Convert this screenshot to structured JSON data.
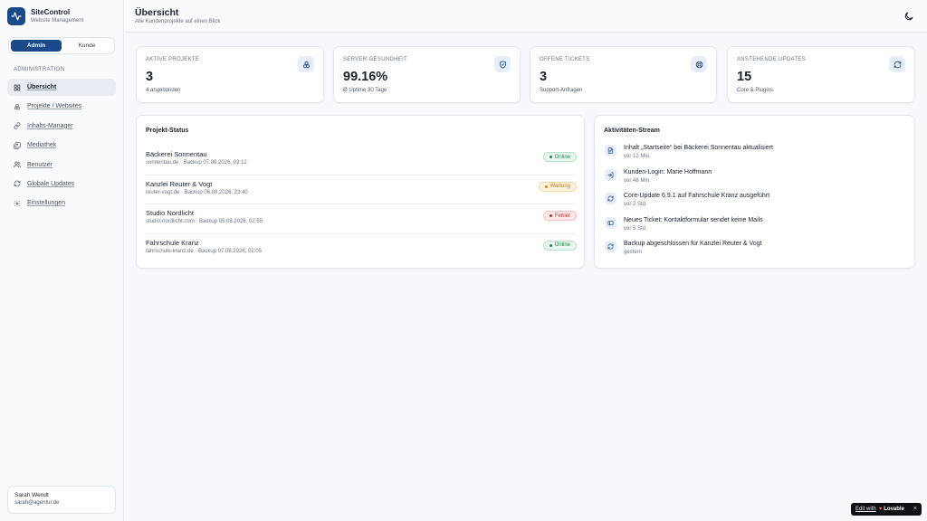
{
  "app": {
    "name": "SiteControl",
    "subtitle": "Website Management"
  },
  "role_toggle": {
    "admin": "Admin",
    "customer": "Kunde",
    "active": "admin"
  },
  "sidebar": {
    "section_label": "ADMINISTRATION",
    "items": [
      {
        "label": "Übersicht",
        "icon": "grid-icon",
        "active": true
      },
      {
        "label": "Projekte / Websites",
        "icon": "boxes-icon",
        "active": false
      },
      {
        "label": "Inhalts-Manager",
        "icon": "link-icon",
        "active": false
      },
      {
        "label": "Mediathek",
        "icon": "images-icon",
        "active": false
      },
      {
        "label": "Benutzer",
        "icon": "users-icon",
        "active": false
      },
      {
        "label": "Globale Updates",
        "icon": "refresh-icon",
        "active": false
      },
      {
        "label": "Einstellungen",
        "icon": "gear-icon",
        "active": false
      }
    ]
  },
  "user": {
    "name": "Sarah Wendt",
    "email": "sarah@agentur.de"
  },
  "header": {
    "title": "Übersicht",
    "subtitle": "Alle Kundenprojekte auf einen Blick",
    "theme_icon": "moon-icon"
  },
  "stats": [
    {
      "label": "AKTIVE PROJEKTE",
      "value": "3",
      "sub": "4 angebunden",
      "icon": "boxes-icon"
    },
    {
      "label": "SERVER-GESUNDHEIT",
      "value": "99.16%",
      "sub": "Ø Uptime 30 Tage",
      "icon": "shield-icon"
    },
    {
      "label": "OFFENE TICKETS",
      "value": "3",
      "sub": "Support-Anfragen",
      "icon": "lifebuoy-icon"
    },
    {
      "label": "ANSTEHENDE UPDATES",
      "value": "15",
      "sub": "Core & Plugins",
      "icon": "refresh-icon"
    }
  ],
  "projects": {
    "title": "Projekt-Status",
    "rows": [
      {
        "name": "Bäckerei Sonnentau",
        "meta": "sonnentau.de · Backup 07.08.2026, 03:12",
        "status": "Online",
        "status_type": "online"
      },
      {
        "name": "Kanzlei Reuter & Vogt",
        "meta": "reuter-vogt.de · Backup 06.08.2026, 23:40",
        "status": "Wartung",
        "status_type": "wartung"
      },
      {
        "name": "Studio Nordlicht",
        "meta": "studio-nordlicht.com · Backup 05.08.2026, 02:55",
        "status": "Fehler",
        "status_type": "fehler"
      },
      {
        "name": "Fahrschule Kranz",
        "meta": "fahrschule-kranz.de · Backup 07.08.2026, 02:05",
        "status": "Online",
        "status_type": "online"
      }
    ]
  },
  "activity": {
    "title": "Aktivitäten-Stream",
    "items": [
      {
        "text": "Inhalt „Startseite“ bei Bäckerei Sonnentau aktualisiert",
        "time": "vor 12 Min.",
        "icon": "file-icon"
      },
      {
        "text": "Kunden-Login: Marie Hoffmann",
        "time": "vor 48 Min.",
        "icon": "login-icon"
      },
      {
        "text": "Core-Update 6.9.1 auf Fahrschule Kranz ausgeführt",
        "time": "vor 2 Std.",
        "icon": "refresh-icon"
      },
      {
        "text": "Neues Ticket: Kontaktformular sendet keine Mails",
        "time": "vor 5 Std.",
        "icon": "ticket-icon"
      },
      {
        "text": "Backup abgeschlossen für Kanzlei Reuter & Vogt",
        "time": "gestern",
        "icon": "refresh-icon"
      }
    ]
  },
  "lovable": {
    "edit": "Edit with",
    "brand": "Lovable",
    "close": "×"
  },
  "colors": {
    "primary": "#1b4a8a",
    "online": "#1f8a4c",
    "warning": "#b7791f",
    "error": "#c53030"
  }
}
